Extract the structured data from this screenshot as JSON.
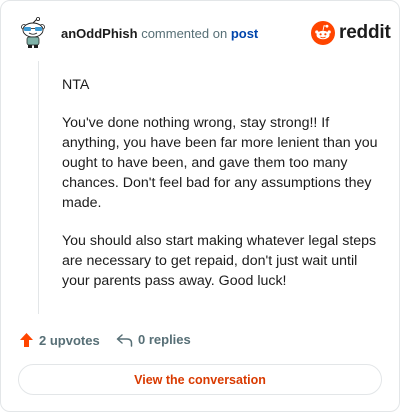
{
  "header": {
    "author": "anOddPhish",
    "action": "commented on",
    "post_link": "post",
    "brand": "reddit"
  },
  "comment": {
    "paragraphs": [
      "NTA",
      "You've done nothing wrong, stay strong!! If anything, you have been far more lenient than you ought to have been, and gave them too many chances. Don't feel bad for any assumptions they made.",
      "You should also start making whatever legal steps are necessary to get repaid, don't just wait until your parents pass away. Good luck!"
    ]
  },
  "footer": {
    "upvotes": "2 upvotes",
    "replies": "0 replies",
    "view_button": "View the conversation"
  },
  "colors": {
    "brand_orange": "#ff4500",
    "link_blue": "#0045ac",
    "button_text": "#d93a00"
  },
  "icons": {
    "avatar": "snoo-avatar-icon",
    "logo": "reddit-logo-icon",
    "upvote": "upvote-arrow-icon",
    "reply": "reply-arrow-icon"
  }
}
